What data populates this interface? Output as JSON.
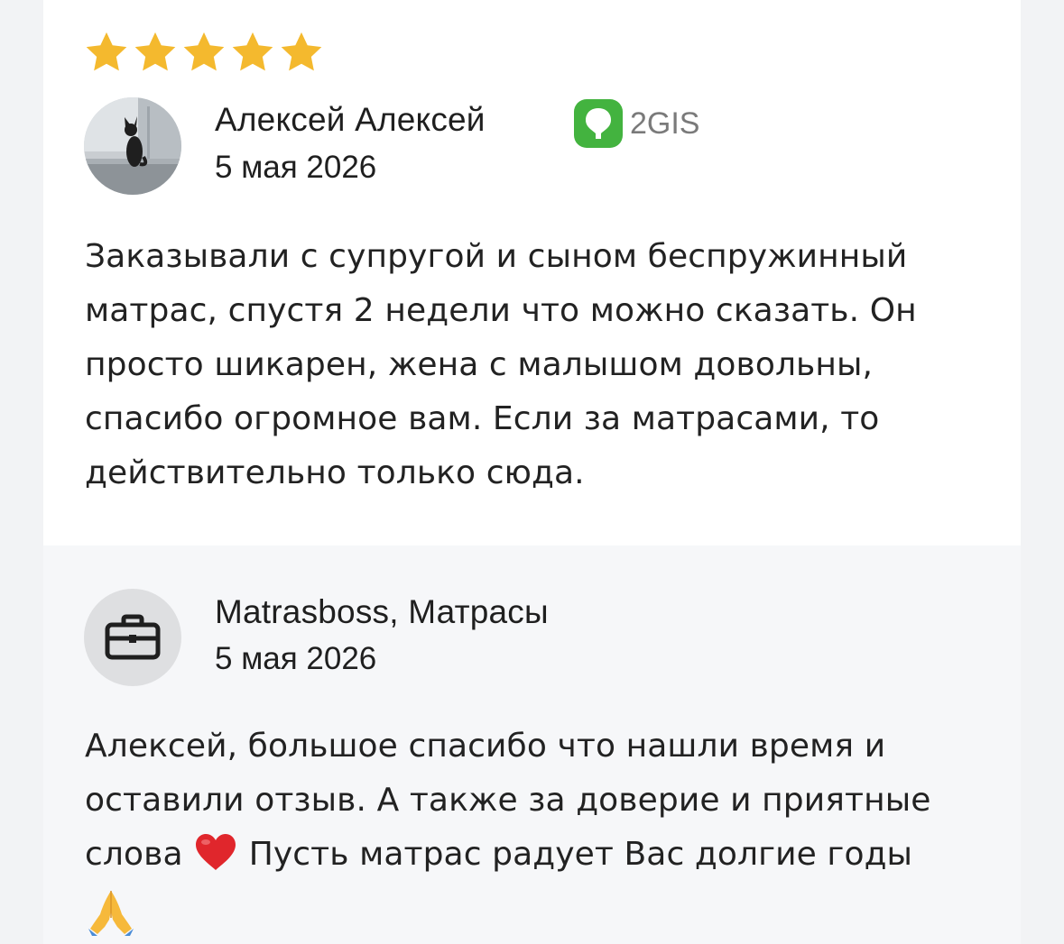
{
  "review": {
    "rating": 5,
    "rating_max": 5,
    "star_color": "#f4b92e",
    "author": "Алексей Алексей",
    "date": "5 мая 2026",
    "source": {
      "icon": "2gis-logo-icon",
      "label": "2GIS",
      "color": "#43b33f"
    },
    "text": "Заказывали с супругой и сыном беспружинный матрас, спустя 2 недели что можно сказать. Он просто шикарен, жена с малышом довольны, спасибо огромное вам. Если за матрасами, то действительно только сюда."
  },
  "reply": {
    "author": "Matrasboss, Матрасы",
    "avatar_icon": "briefcase-icon",
    "date": "5 мая 2026",
    "text_part1": "Алексей, большое спасибо что нашли время и оставили отзыв. А также за доверие и приятные слова",
    "heart_emoji": "red-heart-icon",
    "text_part2": "Пусть матрас радует Вас долгие годы",
    "hands_emoji": "folded-hands-icon"
  }
}
